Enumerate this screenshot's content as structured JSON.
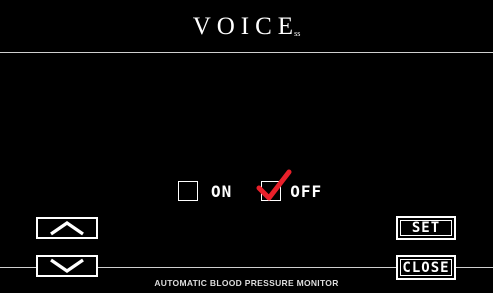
{
  "header": {
    "title": "VOICE",
    "title_mark": "ss"
  },
  "options": [
    {
      "label": "ON",
      "checked": false
    },
    {
      "label": "OFF",
      "checked": true
    }
  ],
  "buttons": {
    "up_icon": "chevron-up-icon",
    "down_icon": "chevron-down-icon",
    "set_label": "SET",
    "close_label": "CLOSE"
  },
  "footer": {
    "text": "AUTOMATIC BLOOD PRESSURE MONITOR"
  },
  "colors": {
    "background": "#000000",
    "foreground": "#ffffff",
    "check_mark": "#e8202a"
  }
}
